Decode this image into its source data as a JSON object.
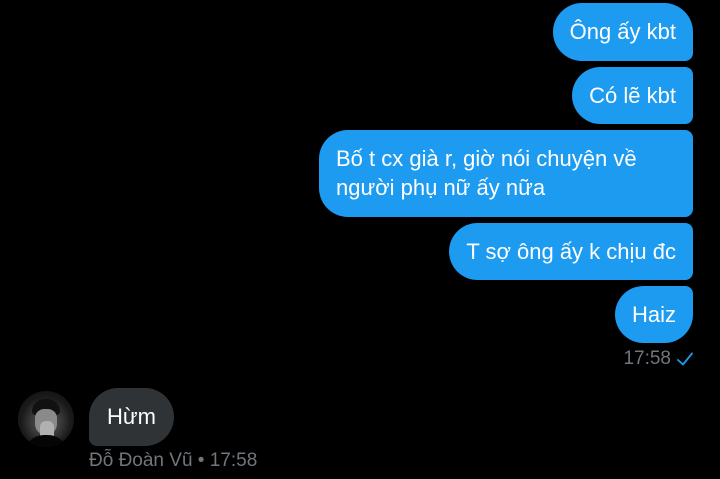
{
  "conversation": {
    "outgoing": [
      {
        "text": "Ông ấy kbt"
      },
      {
        "text": "Có lẽ kbt"
      },
      {
        "text": "Bố t cx già r, giờ nói chuyện về người phụ nữ ấy nữa"
      },
      {
        "text": "T sợ ông ấy k chịu đc"
      },
      {
        "text": "Haiz"
      }
    ],
    "outgoing_time": "17:58",
    "incoming": [
      {
        "text": "Hừm"
      }
    ],
    "incoming_sender": "Đỗ Đoàn Vũ",
    "incoming_separator": "•",
    "incoming_time": "17:58"
  },
  "colors": {
    "background": "#000000",
    "outgoing_bubble": "#1d9bf0",
    "incoming_bubble": "#2f3336",
    "meta_text": "#71767b",
    "check": "#1d9bf0"
  },
  "icons": {
    "read_receipt": "checkmark-icon",
    "avatar": "avatar"
  }
}
